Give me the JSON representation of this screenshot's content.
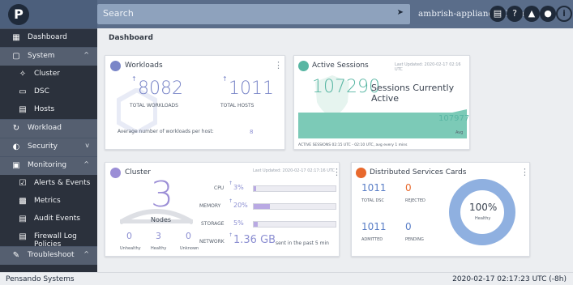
{
  "topbar": {
    "logo": "P",
    "search_placeholder": "Search",
    "cluster_name": "ambrish-appliance-cluster",
    "icons": [
      "notes-icon",
      "help-icon",
      "alerts-icon",
      "user-icon",
      "info-icon"
    ],
    "info_glyph": "i"
  },
  "sidebar": {
    "items": [
      {
        "label": "Dashboard",
        "icon": "dashboard-icon"
      },
      {
        "label": "System",
        "icon": "system-icon",
        "caret": "^"
      },
      {
        "label": "Cluster",
        "icon": "cluster-icon"
      },
      {
        "label": "DSC",
        "icon": "dsc-icon"
      },
      {
        "label": "Hosts",
        "icon": "hosts-icon"
      },
      {
        "label": "Workload",
        "icon": "workload-icon"
      },
      {
        "label": "Security",
        "icon": "security-icon",
        "caret": "v"
      },
      {
        "label": "Monitoring",
        "icon": "monitoring-icon",
        "caret": "^"
      },
      {
        "label": "Alerts & Events",
        "icon": "alerts-events-icon"
      },
      {
        "label": "Metrics",
        "icon": "metrics-icon"
      },
      {
        "label": "Audit Events",
        "icon": "audit-events-icon"
      },
      {
        "label": "Firewall Log Policies",
        "icon": "firewall-log-icon"
      },
      {
        "label": "Troubleshoot",
        "icon": "troubleshoot-icon",
        "caret": "^"
      }
    ]
  },
  "breadcrumb": "Dashboard",
  "workloads": {
    "title": "Workloads",
    "total_workloads": "8082",
    "total_workloads_label": "TOTAL WORKLOADS",
    "total_hosts": "1011",
    "total_hosts_label": "TOTAL HOSTS",
    "avg_label": "Average number of workloads per host:",
    "avg_value": "8"
  },
  "sessions": {
    "title": "Active Sessions",
    "last_updated": "Last Updated: 2020-02-17 02:16 UTC",
    "value": "107290",
    "value_label": "Sessions Currently Active",
    "avg_value": "107977",
    "avg_label": "Avg",
    "footer": "ACTIVE SESSIONS 02:15 UTC - 02:10 UTC, avg every 1 mins"
  },
  "cluster": {
    "title": "Cluster",
    "last_updated": "Last Updated: 2020-02-17 02:17:16 UTC",
    "nodes_count": "3",
    "nodes_label": "Nodes",
    "unhealthy": "0",
    "unhealthy_label": "Unhealthy",
    "healthy": "3",
    "healthy_label": "Healthy",
    "unknown": "0",
    "unknown_label": "Unknown",
    "cpu_label": "CPU",
    "cpu_value": "3%",
    "cpu_pct": 3,
    "memory_label": "MEMORY",
    "memory_value": "20%",
    "memory_pct": 20,
    "storage_label": "STORAGE",
    "storage_value": "5%",
    "storage_pct": 5,
    "network_label": "NETWORK",
    "network_value": "1.36 GB",
    "network_suffix": "sent in the past 5 min"
  },
  "dsc": {
    "title": "Distributed Services Cards",
    "total": "1011",
    "total_label": "TOTAL DSC",
    "rejected": "0",
    "rejected_label": "REJECTED",
    "admitted": "1011",
    "admitted_label": "ADMITTED",
    "pending": "0",
    "pending_label": "PENDING",
    "healthy_percent": "100%",
    "healthy_label": "Healthy"
  },
  "footer": {
    "company": "Pensando Systems",
    "timestamp": "2020-02-17 02:17:23 UTC (-8h)"
  },
  "colors": {
    "accent_purple": "#8c8fd2",
    "accent_teal": "#58b6a3",
    "accent_red": "#e8692d",
    "donut_blue": "#8fb0e0"
  }
}
